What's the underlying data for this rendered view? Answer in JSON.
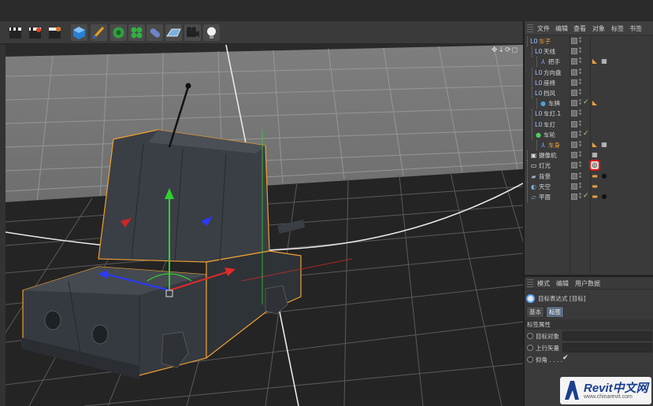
{
  "toolbar": {
    "buttons": [
      {
        "name": "render-view-button",
        "icon": "clapboard-icon"
      },
      {
        "name": "render-picture-viewer-button",
        "icon": "clapboard-red-icon"
      },
      {
        "name": "render-settings-button",
        "icon": "clapboard-gear-icon"
      },
      {
        "name": "cube-button",
        "icon": "cube-icon"
      },
      {
        "name": "pen-button",
        "icon": "pen-icon"
      },
      {
        "name": "subdivision-button",
        "icon": "green-gear-icon"
      },
      {
        "name": "array-button",
        "icon": "green-flower-icon"
      },
      {
        "name": "deformer-button",
        "icon": "capsule-icon"
      },
      {
        "name": "floor-button",
        "icon": "grid-plane-icon"
      },
      {
        "name": "camera-button",
        "icon": "camera-icon"
      },
      {
        "name": "light-button",
        "icon": "lightbulb-icon"
      }
    ]
  },
  "viewport": {
    "nav_icons": "✥↓⟳◻"
  },
  "object_manager": {
    "menu": [
      "文件",
      "编辑",
      "查看",
      "对象",
      "标签",
      "书签"
    ],
    "objects": [
      {
        "name": "车子",
        "icon": "null-icon",
        "highlight": true,
        "depth": 0,
        "tags": []
      },
      {
        "name": "天线",
        "icon": "null-icon",
        "highlight": false,
        "depth": 1,
        "tags": []
      },
      {
        "name": "把手",
        "icon": "joint-icon",
        "highlight": false,
        "depth": 2,
        "tags": [
          "phong-tag",
          "checker-tag"
        ]
      },
      {
        "name": "方向盘",
        "icon": "null-icon",
        "highlight": false,
        "depth": 1,
        "tags": []
      },
      {
        "name": "座椅",
        "icon": "null-icon",
        "highlight": false,
        "depth": 1,
        "tags": []
      },
      {
        "name": "挡风",
        "icon": "null-icon",
        "highlight": false,
        "depth": 1,
        "tags": []
      },
      {
        "name": "车牌",
        "icon": "sphere-icon",
        "highlight": false,
        "depth": 2,
        "tags": [
          "phong-tag"
        ],
        "check": true
      },
      {
        "name": "车灯.1",
        "icon": "null-icon",
        "highlight": false,
        "depth": 1,
        "tags": []
      },
      {
        "name": "车灯",
        "icon": "null-icon",
        "highlight": false,
        "depth": 1,
        "tags": []
      },
      {
        "name": "车轮",
        "icon": "green-sphere-icon",
        "highlight": false,
        "depth": 1,
        "tags": [],
        "check": true
      },
      {
        "name": "车身",
        "icon": "joint-icon",
        "highlight": true,
        "depth": 2,
        "tags": [
          "phong-tag",
          "checker-tag"
        ]
      },
      {
        "name": "摄像机",
        "icon": "camera-icon",
        "highlight": false,
        "depth": 0,
        "tags": [
          "checker-tag"
        ]
      },
      {
        "name": "灯光",
        "icon": "light-icon",
        "highlight": false,
        "depth": 0,
        "tags": [
          "target-tag"
        ],
        "selected_tag": true
      },
      {
        "name": "背景",
        "icon": "background-icon",
        "highlight": false,
        "depth": 0,
        "tags": [
          "compositing-tag",
          "material-tag"
        ]
      },
      {
        "name": "天空",
        "icon": "sky-icon",
        "highlight": false,
        "depth": 0,
        "tags": [
          "compositing-tag"
        ]
      },
      {
        "name": "平面",
        "icon": "plane-icon",
        "highlight": false,
        "depth": 0,
        "tags": [
          "compositing-tag",
          "material-tag"
        ],
        "check": true
      }
    ]
  },
  "attribute_manager": {
    "menu": [
      "模式",
      "编辑",
      "用户数据"
    ],
    "title": "目标表达式 [目标]",
    "tabs": [
      "基本",
      "标签"
    ],
    "active_tab": "标签",
    "section": "标签属性",
    "fields": [
      {
        "label": "目标对象",
        "type": "link"
      },
      {
        "label": "上行矢量",
        "type": "link"
      },
      {
        "label": "仰角 . . . .",
        "type": "checkbox",
        "value": "✔"
      }
    ]
  },
  "watermark": {
    "brand": "Revit中文网",
    "url": "www.chinarevit.com"
  }
}
